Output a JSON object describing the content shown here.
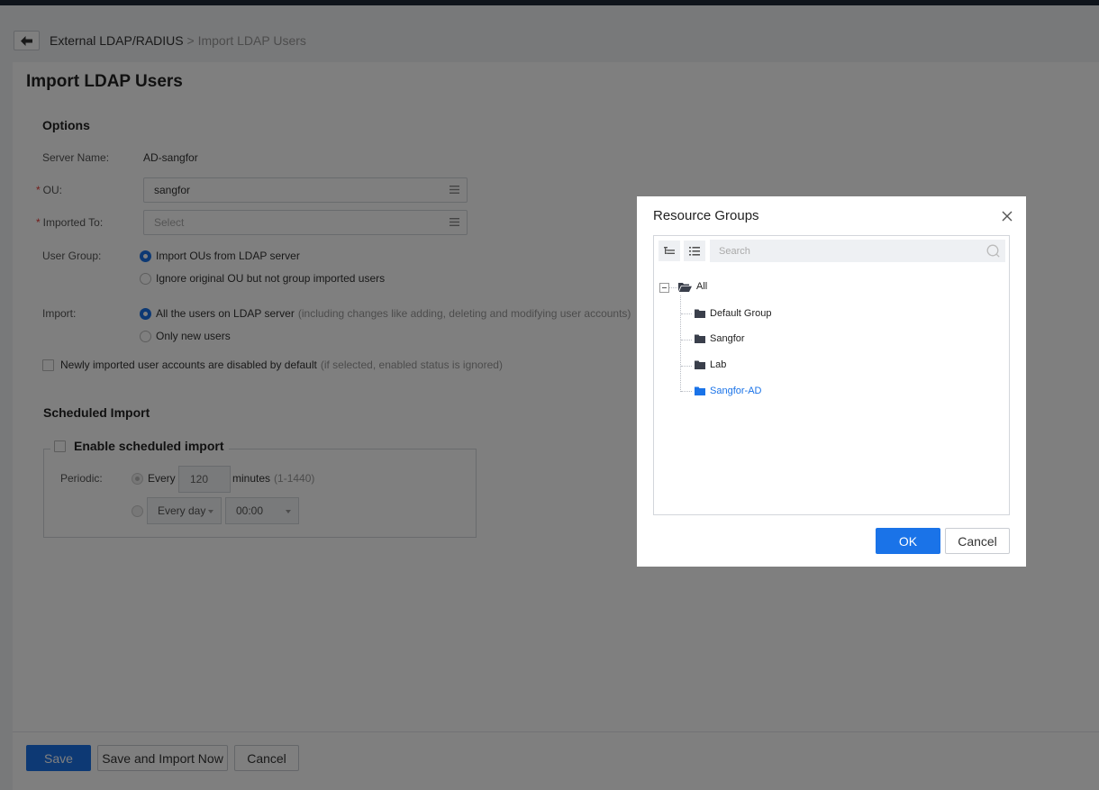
{
  "breadcrumb": {
    "parent": "External LDAP/RADIUS",
    "separator": ">",
    "current": "Import LDAP Users"
  },
  "page": {
    "title": "Import LDAP Users"
  },
  "options": {
    "section_title": "Options",
    "server_name_label": "Server Name:",
    "server_name_value": "AD-sangfor",
    "required_mark": "*",
    "ou_label": "OU:",
    "ou_value": "sangfor",
    "imported_to_label": "Imported To:",
    "imported_to_placeholder": "Select",
    "user_group_label": "User Group:",
    "user_group_options": [
      {
        "label": "Import OUs from LDAP server",
        "selected": true
      },
      {
        "label": "Ignore original OU but not group imported users",
        "selected": false
      }
    ],
    "import_label": "Import:",
    "import_options": [
      {
        "label": "All the users on LDAP server",
        "hint": "(including changes like adding, deleting and modifying user accounts)",
        "selected": true
      },
      {
        "label": "Only new users",
        "hint": "",
        "selected": false
      }
    ],
    "disabled_default_label": "Newly imported user accounts are disabled by default",
    "disabled_default_hint": "(if selected, enabled status is ignored)"
  },
  "scheduled": {
    "section_title": "Scheduled Import",
    "enable_label": "Enable scheduled import",
    "periodic_label": "Periodic:",
    "every_label": "Every",
    "minutes_value": "120",
    "minutes_unit": "minutes",
    "minutes_range": "(1-1440)",
    "day_select": "Every day",
    "time_select": "00:00"
  },
  "footer": {
    "save": "Save",
    "save_import": "Save and Import Now",
    "cancel": "Cancel"
  },
  "dialog": {
    "title": "Resource Groups",
    "search_placeholder": "Search",
    "tree": {
      "root": "All",
      "children": [
        "Default Group",
        "Sangfor",
        "Lab",
        "Sangfor-AD"
      ],
      "selected": "Sangfor-AD"
    },
    "ok": "OK",
    "cancel": "Cancel"
  },
  "colors": {
    "primary": "#1a73e8",
    "required": "#e53935",
    "folder": "#3a3f4b"
  }
}
